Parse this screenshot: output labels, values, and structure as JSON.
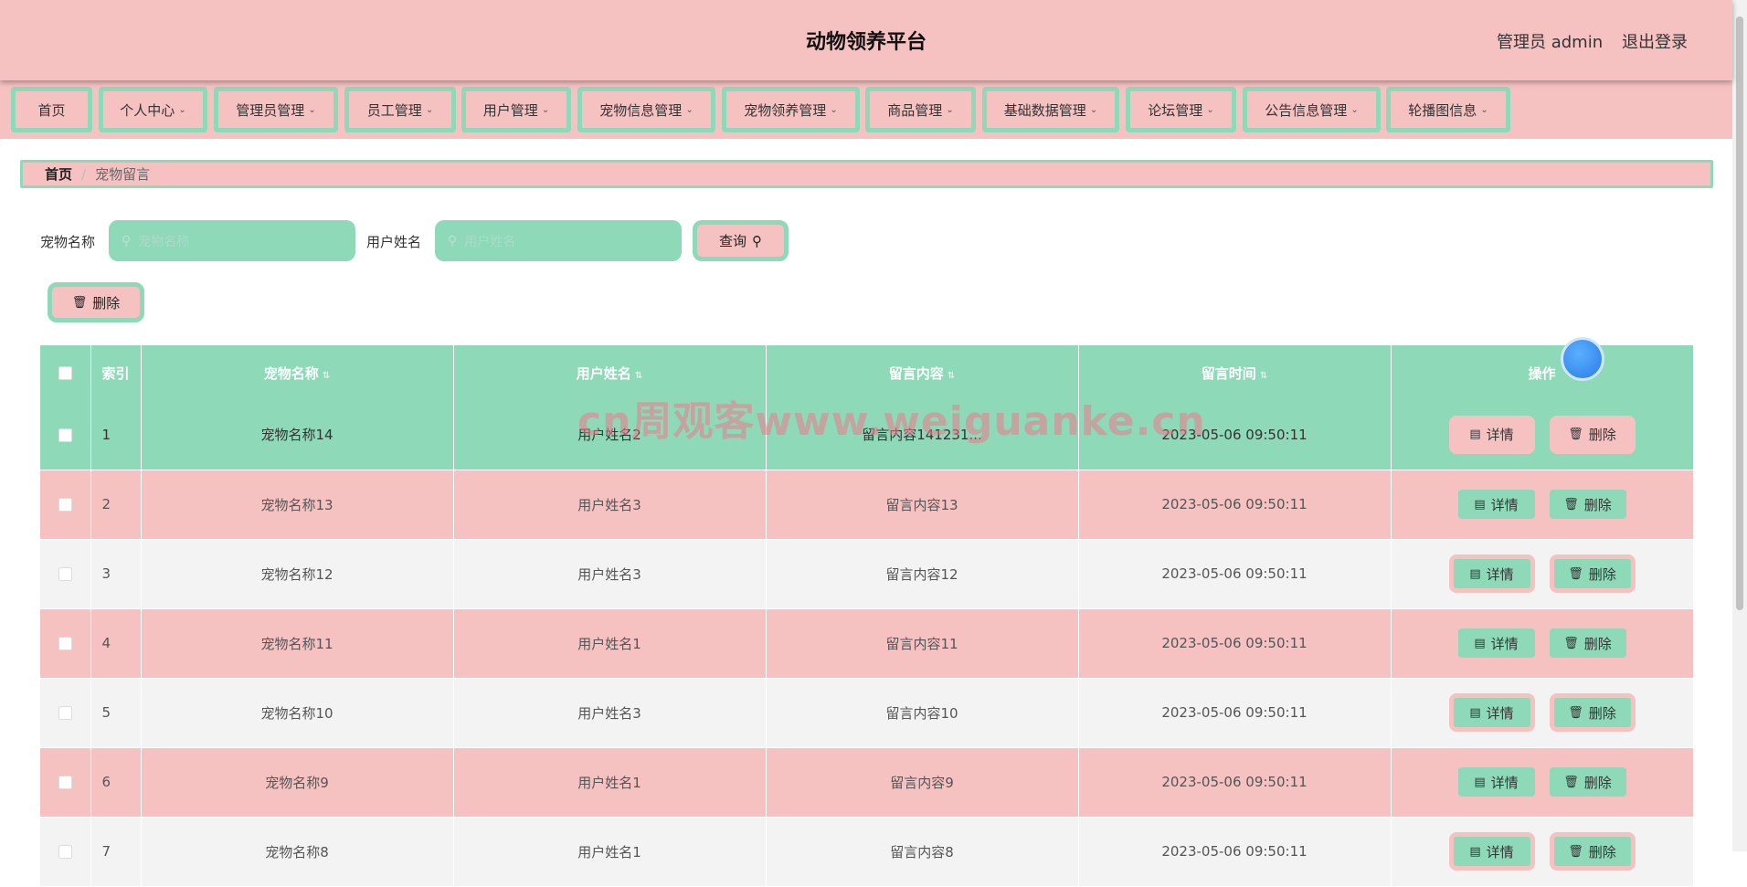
{
  "header": {
    "title": "动物领养平台",
    "user": "管理员 admin",
    "logout": "退出登录"
  },
  "nav": [
    {
      "label": "首页",
      "chev": ""
    },
    {
      "label": "个人中心",
      "chev": "⌄"
    },
    {
      "label": "管理员管理",
      "chev": "⌄"
    },
    {
      "label": "员工管理",
      "chev": "⌄"
    },
    {
      "label": "用户管理",
      "chev": "⌄"
    },
    {
      "label": "宠物信息管理",
      "chev": "⌄"
    },
    {
      "label": "宠物领养管理",
      "chev": "⌄"
    },
    {
      "label": "商品管理",
      "chev": "⌄"
    },
    {
      "label": "基础数据管理",
      "chev": "⌄"
    },
    {
      "label": "论坛管理",
      "chev": "⌄"
    },
    {
      "label": "公告信息管理",
      "chev": "⌄"
    },
    {
      "label": "轮播图信息",
      "chev": "⌄"
    }
  ],
  "breadcrumb": {
    "home": "首页",
    "sep": "/",
    "current": "宠物留言"
  },
  "search": {
    "pet_label": "宠物名称",
    "pet_placeholder": "宠物名称",
    "user_label": "用户姓名",
    "user_placeholder": "用户姓名",
    "query_label": "查询",
    "search_glyph": "⚲",
    "field_glyph": "⚲"
  },
  "toolbar": {
    "delete_label": "删除",
    "delete_glyph": "🗑"
  },
  "table": {
    "headers": {
      "index": "索引",
      "pet_name": "宠物名称",
      "user_name": "用户姓名",
      "content": "留言内容",
      "time": "留言时间",
      "ops": "操作"
    },
    "sort_glyph": "⇅",
    "rows": [
      {
        "index": "1",
        "pet_name": "宠物名称14",
        "user_name": "用户姓名2",
        "content": "留言内容141231...",
        "time": "2023-05-06 09:50:11"
      },
      {
        "index": "2",
        "pet_name": "宠物名称13",
        "user_name": "用户姓名3",
        "content": "留言内容13",
        "time": "2023-05-06 09:50:11"
      },
      {
        "index": "3",
        "pet_name": "宠物名称12",
        "user_name": "用户姓名3",
        "content": "留言内容12",
        "time": "2023-05-06 09:50:11"
      },
      {
        "index": "4",
        "pet_name": "宠物名称11",
        "user_name": "用户姓名1",
        "content": "留言内容11",
        "time": "2023-05-06 09:50:11"
      },
      {
        "index": "5",
        "pet_name": "宠物名称10",
        "user_name": "用户姓名3",
        "content": "留言内容10",
        "time": "2023-05-06 09:50:11"
      },
      {
        "index": "6",
        "pet_name": "宠物名称9",
        "user_name": "用户姓名1",
        "content": "留言内容9",
        "time": "2023-05-06 09:50:11"
      },
      {
        "index": "7",
        "pet_name": "宠物名称8",
        "user_name": "用户姓名1",
        "content": "留言内容8",
        "time": "2023-05-06 09:50:11"
      }
    ],
    "detail_label": "详情",
    "delete_label": "删除",
    "detail_glyph": "▤",
    "delete_glyph": "🗑"
  },
  "watermark": "cn周观客www.weiguanke.cn",
  "colors": {
    "pink": "#f6c1c1",
    "green": "#8dd9b8"
  }
}
